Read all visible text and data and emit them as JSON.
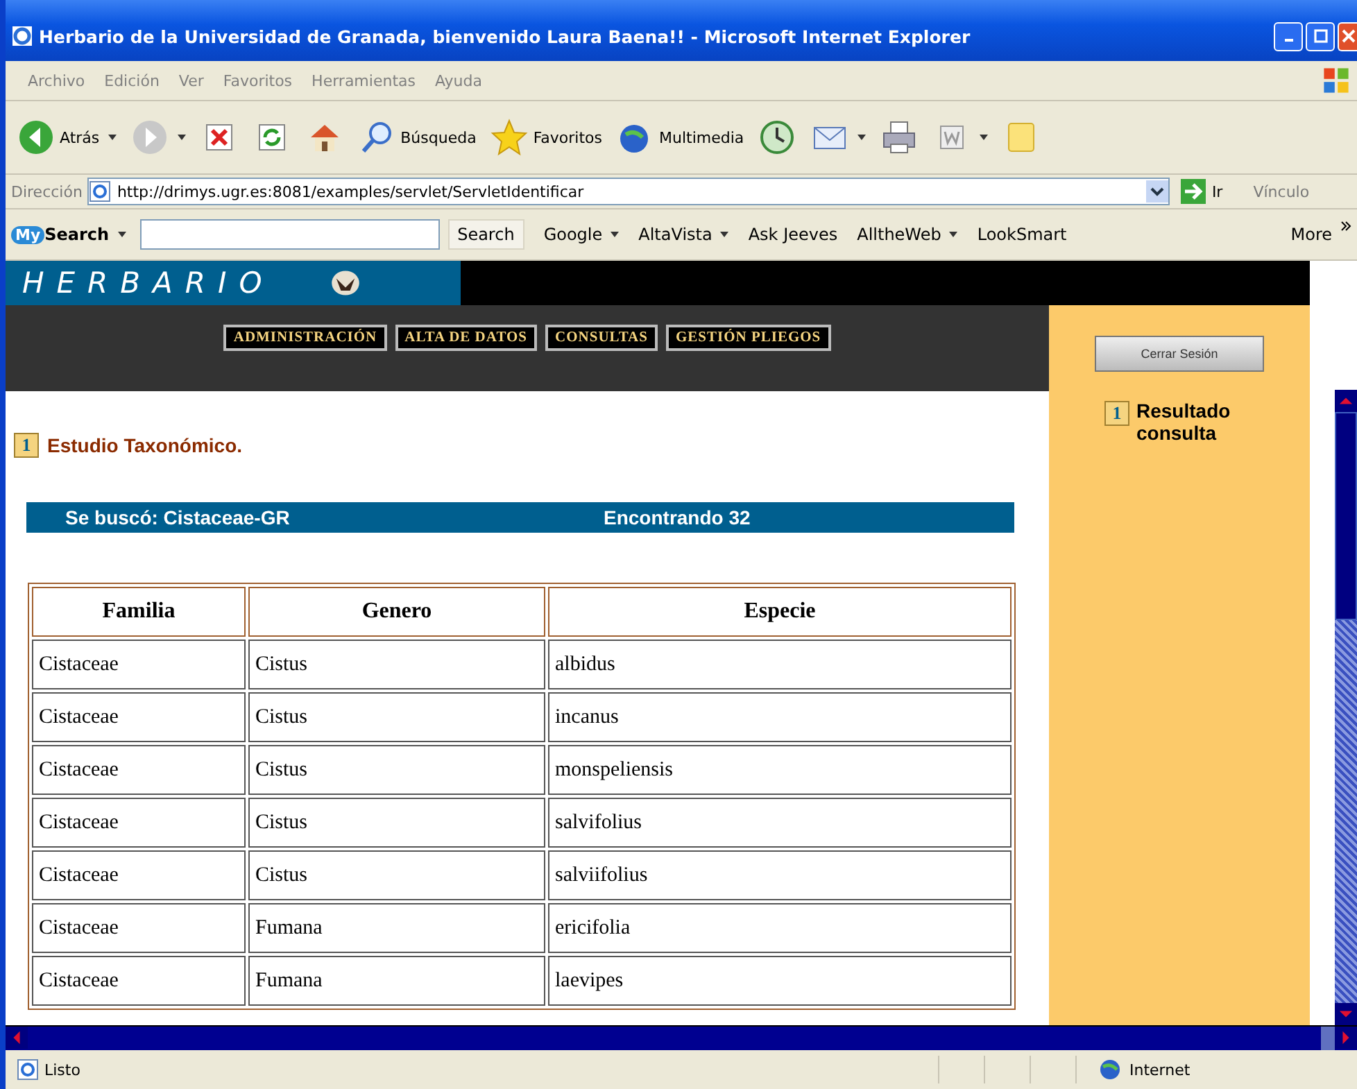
{
  "window": {
    "title": "Herbario de la Universidad de Granada, bienvenido Laura Baena!! - Microsoft Internet Explorer"
  },
  "menu": [
    "Archivo",
    "Edición",
    "Ver",
    "Favoritos",
    "Herramientas",
    "Ayuda"
  ],
  "toolbar": [
    {
      "kind": "back",
      "label": "Atrás",
      "dropdown": true
    },
    {
      "kind": "forward",
      "dropdown": true
    },
    {
      "kind": "stop"
    },
    {
      "kind": "refresh"
    },
    {
      "kind": "home"
    },
    {
      "kind": "search",
      "label": "Búsqueda"
    },
    {
      "kind": "favorites",
      "label": "Favoritos"
    },
    {
      "kind": "media",
      "label": "Multimedia"
    },
    {
      "kind": "history"
    },
    {
      "kind": "mail",
      "dropdown": true
    },
    {
      "kind": "print"
    },
    {
      "kind": "edit",
      "dropdown": true
    },
    {
      "kind": "note"
    }
  ],
  "address": {
    "label": "Dirección",
    "url": "http://drimys.ugr.es:8081/examples/servlet/ServletIdentificar",
    "go": "Ir",
    "links": "Vínculo"
  },
  "search_bar": {
    "logo": "My",
    "brand": "Search",
    "button": "Search",
    "engines": [
      {
        "label": "Google",
        "dropdown": true
      },
      {
        "label": "AltaVista",
        "dropdown": true
      },
      {
        "label": "Ask Jeeves",
        "dropdown": false
      },
      {
        "label": "AlltheWeb",
        "dropdown": true
      },
      {
        "label": "LookSmart",
        "dropdown": false
      }
    ],
    "more": "More"
  },
  "page": {
    "banner": "HERBARIO",
    "nav": [
      "ADMINISTRACIÓN",
      "ALTA DE DATOS",
      "CONSULTAS",
      "GESTIÓN PLIEGOS"
    ],
    "logout": "Cerrar Sesión",
    "section": {
      "number": "1",
      "title": "Estudio Taxonómico."
    },
    "summary": {
      "query": "Se buscó: Cistaceae-GR",
      "count": "Encontrando 32"
    },
    "table": {
      "columns": [
        "Familia",
        "Genero",
        "Especie"
      ],
      "rows": [
        [
          "Cistaceae",
          "Cistus",
          "albidus"
        ],
        [
          "Cistaceae",
          "Cistus",
          "incanus"
        ],
        [
          "Cistaceae",
          "Cistus",
          "monspeliensis"
        ],
        [
          "Cistaceae",
          "Cistus",
          "salvifolius"
        ],
        [
          "Cistaceae",
          "Cistus",
          "salviifolius"
        ],
        [
          "Cistaceae",
          "Fumana",
          "ericifolia"
        ],
        [
          "Cistaceae",
          "Fumana",
          "laevipes"
        ]
      ]
    },
    "sidebar": {
      "number": "1",
      "title": "Resultado consulta"
    }
  },
  "status_bar": {
    "text": "Listo",
    "zone": "Internet"
  }
}
